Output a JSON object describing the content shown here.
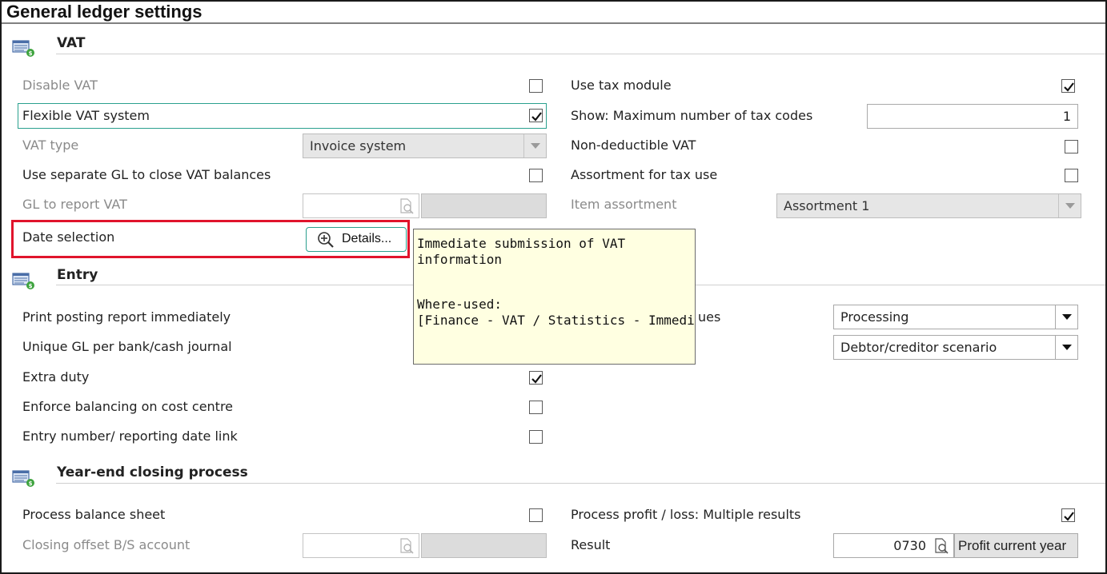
{
  "page": {
    "title": "General ledger settings"
  },
  "sections": {
    "vat": {
      "title": "VAT"
    },
    "entry": {
      "title": "Entry"
    },
    "year_end": {
      "title": "Year-end closing process"
    }
  },
  "vat": {
    "disable_vat": {
      "label": "Disable VAT",
      "checked": false
    },
    "flexible_vat": {
      "label": "Flexible VAT system",
      "checked": true
    },
    "vat_type": {
      "label": "VAT type",
      "value": "Invoice system"
    },
    "separate_gl": {
      "label": "Use separate GL to close VAT balances",
      "checked": false
    },
    "gl_report": {
      "label": "GL to report VAT",
      "value": ""
    },
    "date_selection": {
      "label": "Date selection",
      "button": "Details..."
    },
    "use_tax_module": {
      "label": "Use tax module",
      "checked": true
    },
    "max_tax_codes": {
      "label": "Show: Maximum number of tax codes",
      "value": "1"
    },
    "non_deductible": {
      "label": "Non-deductible VAT",
      "checked": false
    },
    "assortment_tax": {
      "label": "Assortment for tax use",
      "checked": false
    },
    "item_assortment": {
      "label": "Item assortment",
      "value": "Assortment 1"
    }
  },
  "tooltip": {
    "line1": "Immediate submission of VAT",
    "line2": "information",
    "line3": "Where-used:",
    "line4": "[Finance - VAT / Statistics - Immediate"
  },
  "entry": {
    "print_posting": {
      "label": "Print posting report immediately"
    },
    "unique_gl": {
      "label": "Unique GL per bank/cash journal"
    },
    "extra_duty": {
      "label": "Extra duty",
      "checked": true
    },
    "enforce_balancing": {
      "label": "Enforce balancing on cost centre",
      "checked": false
    },
    "entry_number": {
      "label": "Entry number/ reporting date link",
      "checked": false
    },
    "right_label_partial": "ues",
    "processing": {
      "value": "Processing"
    },
    "scenario": {
      "value": "Debtor/creditor scenario"
    }
  },
  "year_end": {
    "process_balance": {
      "label": "Process balance sheet",
      "checked": false
    },
    "closing_offset": {
      "label": "Closing offset B/S account",
      "value": ""
    },
    "process_pl": {
      "label": "Process profit / loss: Multiple results",
      "checked": true
    },
    "result": {
      "label": "Result",
      "value": "0730",
      "button": "Profit current year"
    }
  },
  "icons": {
    "section": "ledger-settings-icon",
    "lookup": "lookup-magnifier-icon",
    "zoom": "zoom-in-icon",
    "check": "checkmark-icon",
    "dropdown": "chevron-down-icon"
  }
}
